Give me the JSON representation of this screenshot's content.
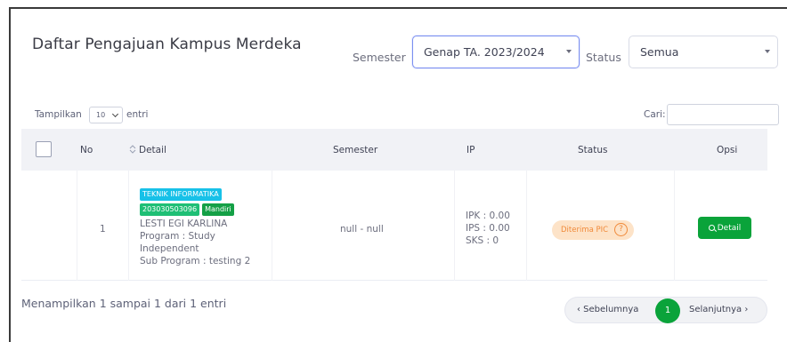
{
  "page": {
    "title": "Daftar Pengajuan Kampus Merdeka"
  },
  "filters": {
    "semester_label": "Semester",
    "semester_value": "Genap TA. 2023/2024",
    "status_label": "Status",
    "status_value": "Semua"
  },
  "table_controls": {
    "show_label": "Tampilkan",
    "entries_value": "10",
    "entries_suffix": "entri",
    "search_label": "Cari:",
    "search_value": ""
  },
  "table": {
    "columns": [
      "No",
      "Detail",
      "Semester",
      "IP",
      "Status",
      "Opsi"
    ],
    "rows": [
      {
        "no": "1",
        "prodi": "TEKNIK INFORMATIKA",
        "nim": "203030503096",
        "jenis": "Mandiri",
        "name": "LESTI EGI KARLINA",
        "program_line1": "Program : Study",
        "program_line2": "Independent",
        "sub_program": "Sub Program : testing 2",
        "semester": "null - null",
        "ipk": "IPK : 0.00",
        "ips": "IPS : 0.00",
        "sks": "SKS : 0",
        "status": "Diterima PIC",
        "action": "Detail"
      }
    ]
  },
  "footer": {
    "info": "Menampilkan 1 sampai 1 dari 1 entri",
    "prev": "‹ Sebelumnya",
    "current_page": "1",
    "next": "Selanjutnya ›"
  },
  "colors": {
    "accent_green": "#0aa33a",
    "badge_cyan": "#17c1e8",
    "status_orange": "#f08a3a",
    "focus_border": "#7b8ff0"
  },
  "icons": [
    "caret-down-icon",
    "chevron-down-icon",
    "checkbox-icon",
    "sort-icon",
    "help-circle-icon",
    "search-icon"
  ]
}
